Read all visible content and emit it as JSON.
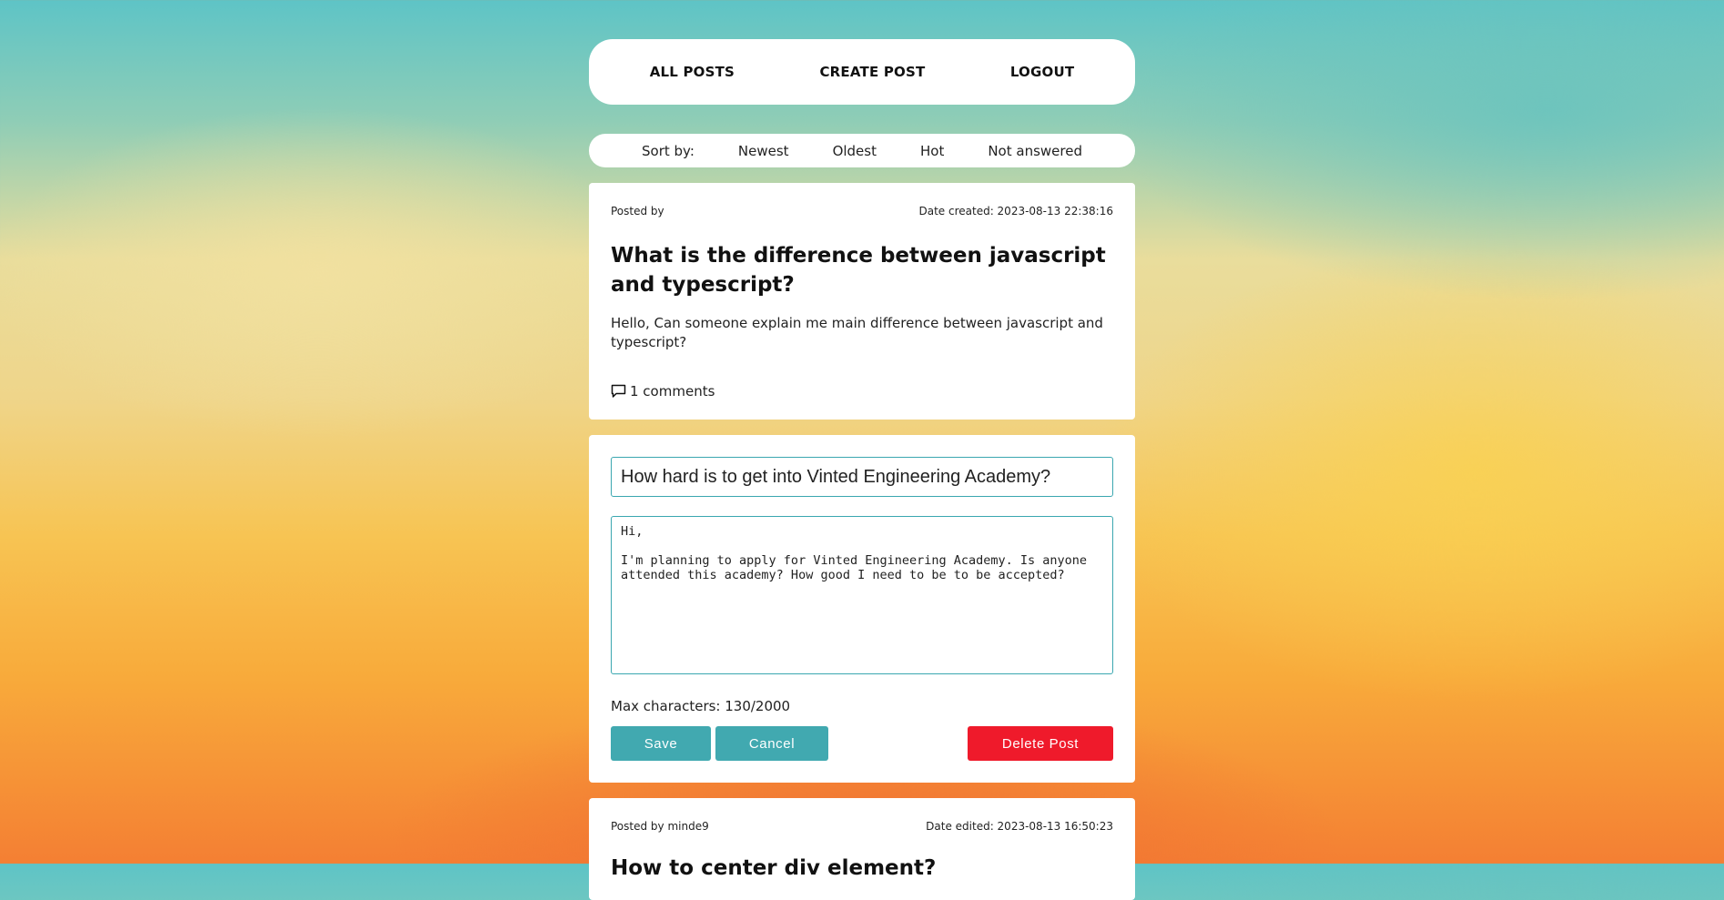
{
  "nav": {
    "all_posts": "ALL POSTS",
    "create_post": "CREATE POST",
    "logout": "LOGOUT"
  },
  "sort": {
    "label": "Sort by:",
    "options": [
      "Newest",
      "Oldest",
      "Hot",
      "Not answered"
    ]
  },
  "posts": [
    {
      "posted_by": "Posted by",
      "date": "Date created: 2023-08-13 22:38:16",
      "title": "What is the difference between javascript and typescript?",
      "body": "Hello, Can someone explain me main difference between javascript and typescript?",
      "comments": "1 comments",
      "comment_icon": "comment-icon"
    }
  ],
  "edit": {
    "title_value": "How hard is to get into Vinted Engineering Academy?",
    "body_value": "Hi,\n\nI'm planning to apply for Vinted Engineering Academy. Is anyone attended this academy? How good I need to be to be accepted?",
    "char_count": "Max characters: 130/2000",
    "save_label": "Save",
    "cancel_label": "Cancel",
    "delete_label": "Delete Post"
  },
  "next_post": {
    "posted_by": "Posted by minde9",
    "date": "Date edited: 2023-08-13 16:50:23",
    "title": "How to center div element?"
  },
  "colors": {
    "accent": "#41a9b0",
    "danger": "#ef1a2b",
    "card": "#ffffff"
  }
}
